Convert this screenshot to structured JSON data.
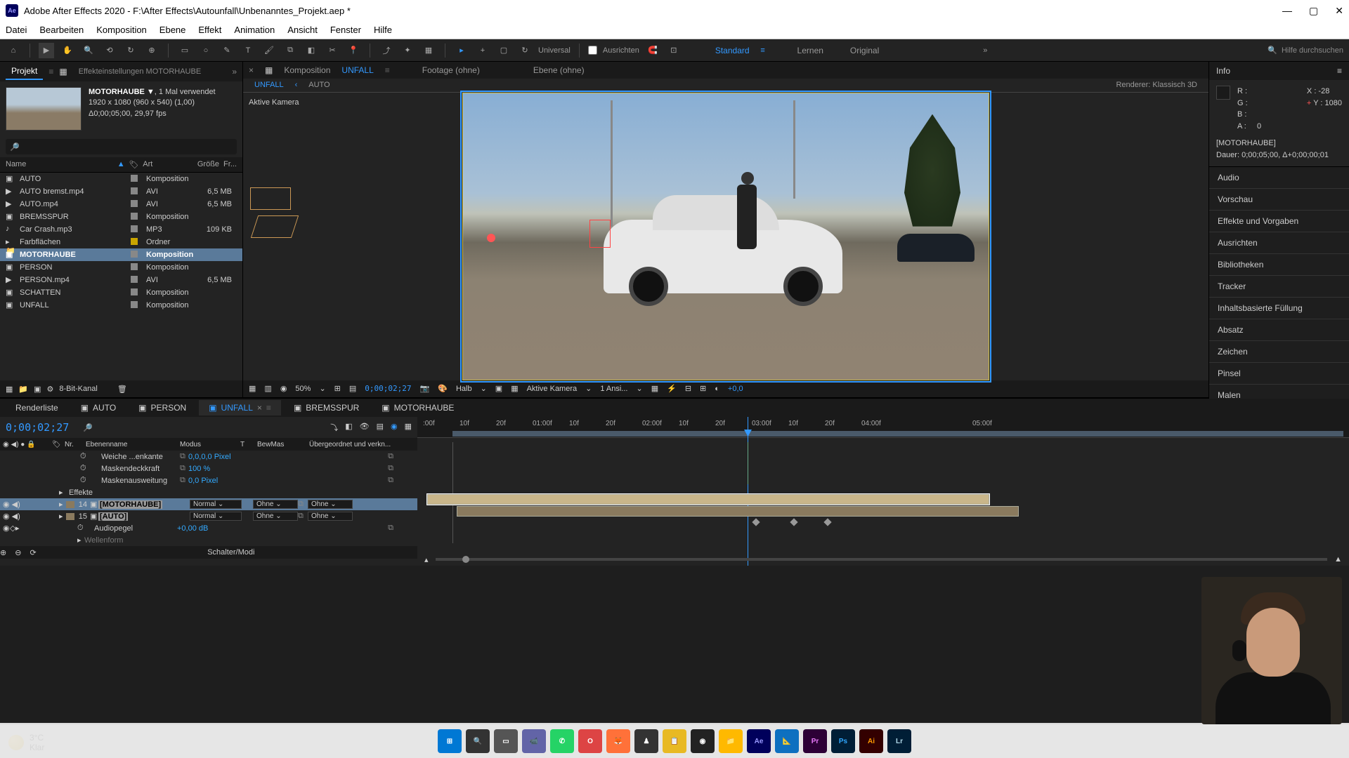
{
  "title": "Adobe After Effects 2020 - F:\\After Effects\\Autounfall\\Unbenanntes_Projekt.aep *",
  "menus": [
    "Datei",
    "Bearbeiten",
    "Komposition",
    "Ebene",
    "Effekt",
    "Animation",
    "Ansicht",
    "Fenster",
    "Hilfe"
  ],
  "toolbar": {
    "universal": "Universal",
    "ausrichten": "Ausrichten",
    "ws_active": "Standard",
    "ws2": "Lernen",
    "ws3": "Original",
    "search": "Hilfe durchsuchen"
  },
  "project": {
    "tab_project": "Projekt",
    "tab_effects": "Effekteinstellungen MOTORHAUBE",
    "asset_name": "MOTORHAUBE ▼",
    "asset_used": ", 1 Mal verwendet",
    "asset_dim": "1920 x 1080 (960 x 540) (1,00)",
    "asset_dur": "Δ0;00;05;00, 29,97 fps",
    "cols": {
      "name": "Name",
      "art": "Art",
      "size": "Größe",
      "fr": "Fr..."
    },
    "items": [
      {
        "name": "AUTO",
        "art": "Komposition",
        "size": "",
        "kind": "comp"
      },
      {
        "name": "AUTO bremst.mp4",
        "art": "AVI",
        "size": "6,5 MB",
        "kind": "vid"
      },
      {
        "name": "AUTO.mp4",
        "art": "AVI",
        "size": "6,5 MB",
        "kind": "vid"
      },
      {
        "name": "BREMSSPUR",
        "art": "Komposition",
        "size": "",
        "kind": "comp"
      },
      {
        "name": "Car Crash.mp3",
        "art": "MP3",
        "size": "109 KB",
        "kind": "aud"
      },
      {
        "name": "Farbflächen",
        "art": "Ordner",
        "size": "",
        "kind": "folder"
      },
      {
        "name": "MOTORHAUBE",
        "art": "Komposition",
        "size": "",
        "kind": "comp",
        "sel": true
      },
      {
        "name": "PERSON",
        "art": "Komposition",
        "size": "",
        "kind": "comp"
      },
      {
        "name": "PERSON.mp4",
        "art": "AVI",
        "size": "6,5 MB",
        "kind": "vid"
      },
      {
        "name": "SCHATTEN",
        "art": "Komposition",
        "size": "",
        "kind": "comp"
      },
      {
        "name": "UNFALL",
        "art": "Komposition",
        "size": "",
        "kind": "comp"
      }
    ],
    "footer_bit": "8-Bit-Kanal"
  },
  "comp": {
    "tab_comp": "Komposition",
    "tab_comp_name": "UNFALL",
    "tab_footage": "Footage (ohne)",
    "tab_layer": "Ebene (ohne)",
    "breadcrumb1": "UNFALL",
    "breadcrumb2": "AUTO",
    "renderer_lbl": "Renderer:",
    "renderer_val": "Klassisch 3D",
    "camera_label": "Aktive Kamera",
    "zoom": "50%",
    "time": "0;00;02;27",
    "res": "Halb",
    "view": "Aktive Kamera",
    "views": "1 Ansi...",
    "exp": "+0,0"
  },
  "info": {
    "title": "Info",
    "r": "R :",
    "g": "G :",
    "b": "B :",
    "a": "A :",
    "a_val": "0",
    "x": "X : -28",
    "y": "Y : 1080",
    "layer": "[MOTORHAUBE]",
    "dauer": "Dauer: 0;00;05;00, Δ+0;00;00;01"
  },
  "side_panels": [
    "Audio",
    "Vorschau",
    "Effekte und Vorgaben",
    "Ausrichten",
    "Bibliotheken",
    "Tracker",
    "Inhaltsbasierte Füllung",
    "Absatz",
    "Zeichen",
    "Pinsel",
    "Malen"
  ],
  "timeline": {
    "tabs": [
      "Renderliste",
      "AUTO",
      "PERSON",
      "UNFALL",
      "BREMSSPUR",
      "MOTORHAUBE"
    ],
    "active_tab": "UNFALL",
    "time": "0;00;02;27",
    "cols": {
      "nr": "Nr.",
      "name": "Ebenenname",
      "modus": "Modus",
      "t": "T",
      "bewmas": "BewMas",
      "parent": "Übergeordnet und verkn..."
    },
    "ticks": [
      ":00f",
      "10f",
      "20f",
      "01:00f",
      "10f",
      "20f",
      "02:00f",
      "10f",
      "20f",
      "03:00f",
      "10f",
      "20f",
      "04:00f",
      "05:00f"
    ],
    "props": [
      {
        "label": "Weiche ...enkante",
        "val": "0,0,0,0 Pixel"
      },
      {
        "label": "Maskendeckkraft",
        "val": "100 %"
      },
      {
        "label": "Maskenausweitung",
        "val": "0,0 Pixel"
      }
    ],
    "effects_label": "Effekte",
    "layers": [
      {
        "nr": "14",
        "name": "[MOTORHAUBE]",
        "mode": "Normal",
        "trk": "Ohne",
        "parent": "Ohne",
        "sel": true
      },
      {
        "nr": "15",
        "name": "[AUTO]",
        "mode": "Normal",
        "trk": "Ohne",
        "parent": "Ohne"
      }
    ],
    "audiopegel_label": "Audiopegel",
    "audiopegel_val": "+0,00 dB",
    "wellenform": "Wellenform",
    "schalter": "Schalter/Modi"
  },
  "weather": {
    "temp": "3°C",
    "cond": "Klar"
  },
  "taskbar_apps": [
    {
      "bg": "#0078d4",
      "fg": "#fff",
      "t": "⊞"
    },
    {
      "bg": "#333",
      "fg": "#fff",
      "t": "🔍"
    },
    {
      "bg": "#555",
      "fg": "#fff",
      "t": "▭"
    },
    {
      "bg": "#6264a7",
      "fg": "#fff",
      "t": "📹"
    },
    {
      "bg": "#25d366",
      "fg": "#fff",
      "t": "✆"
    },
    {
      "bg": "#d44",
      "fg": "#fff",
      "t": "O"
    },
    {
      "bg": "#ff7139",
      "fg": "#fff",
      "t": "🦊"
    },
    {
      "bg": "#333",
      "fg": "#fff",
      "t": "♟"
    },
    {
      "bg": "#e8b923",
      "fg": "#000",
      "t": "📋"
    },
    {
      "bg": "#222",
      "fg": "#fff",
      "t": "◉"
    },
    {
      "bg": "#ffb900",
      "fg": "#000",
      "t": "📁"
    },
    {
      "bg": "#00005b",
      "fg": "#9999ff",
      "t": "Ae"
    },
    {
      "bg": "#0e70c0",
      "fg": "#fff",
      "t": "📐"
    },
    {
      "bg": "#2d0036",
      "fg": "#e879f9",
      "t": "Pr"
    },
    {
      "bg": "#001e36",
      "fg": "#31a8ff",
      "t": "Ps"
    },
    {
      "bg": "#330000",
      "fg": "#ff9a00",
      "t": "Ai"
    },
    {
      "bg": "#001e36",
      "fg": "#b0d8e8",
      "t": "Lr"
    }
  ]
}
